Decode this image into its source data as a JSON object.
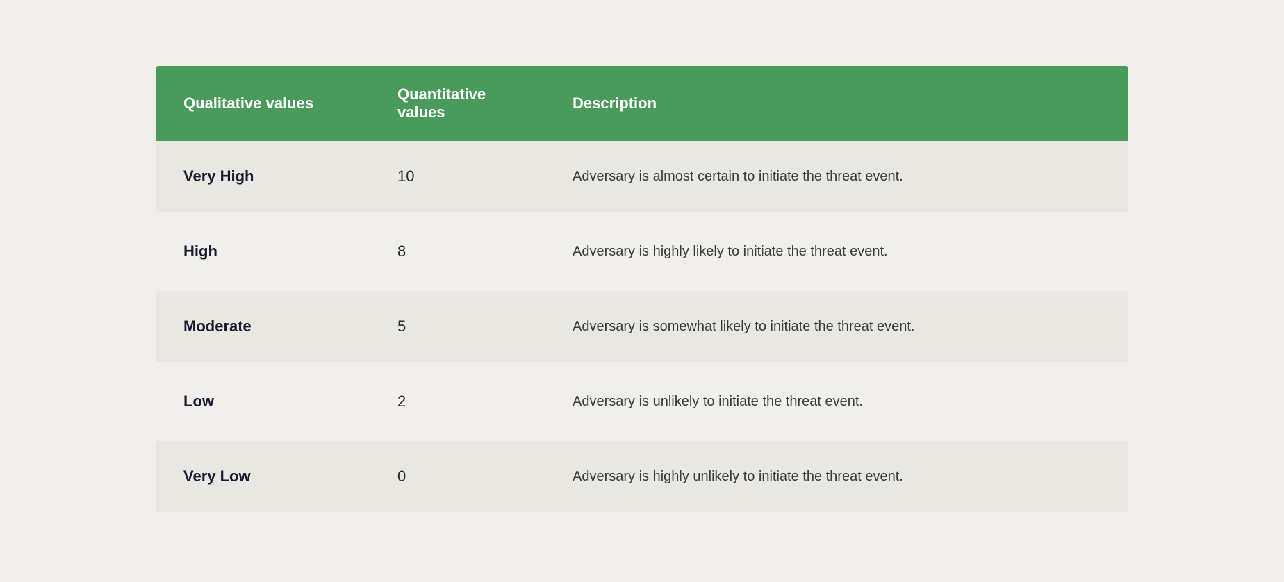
{
  "table": {
    "headers": {
      "col1": "Qualitative values",
      "col2": "Quantitative values",
      "col3": "Description"
    },
    "rows": [
      {
        "qualitative": "Very High",
        "quantitative": "10",
        "description": "Adversary is almost certain to initiate the threat event."
      },
      {
        "qualitative": "High",
        "quantitative": "8",
        "description": "Adversary is highly likely to initiate the threat event."
      },
      {
        "qualitative": "Moderate",
        "quantitative": "5",
        "description": "Adversary is somewhat likely to initiate the threat event."
      },
      {
        "qualitative": "Low",
        "quantitative": "2",
        "description": "Adversary is unlikely to initiate the threat event."
      },
      {
        "qualitative": "Very Low",
        "quantitative": "0",
        "description": "Adversary is highly unlikely to initiate the threat event."
      }
    ]
  }
}
